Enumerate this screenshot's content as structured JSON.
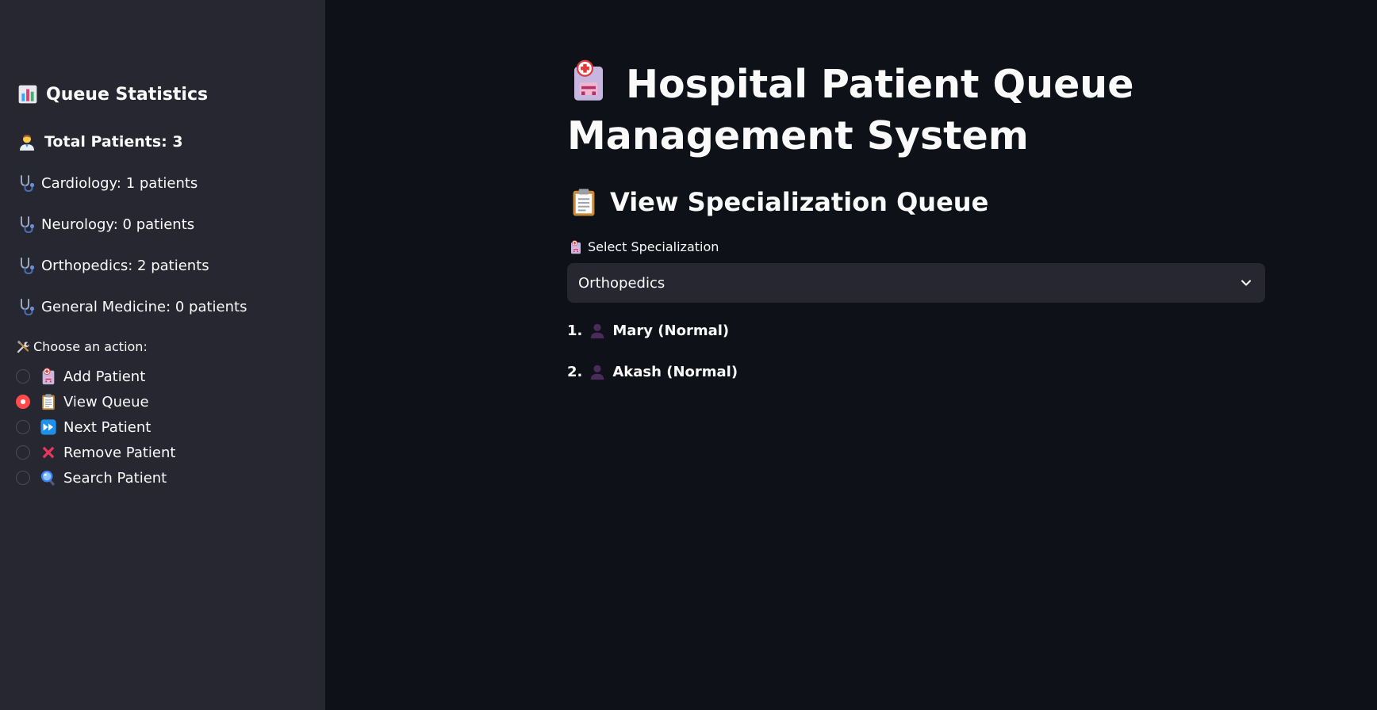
{
  "sidebar": {
    "stats_title": "Queue Statistics",
    "total_patients": "Total Patients: 3",
    "specializations": [
      {
        "label": "Cardiology: 1 patients"
      },
      {
        "label": "Neurology: 0 patients"
      },
      {
        "label": "Orthopedics: 2 patients"
      },
      {
        "label": "General Medicine: 0 patients"
      }
    ],
    "action_label": "Choose an action:",
    "actions": [
      {
        "label": "Add Patient",
        "icon": "hospital-icon",
        "selected": false
      },
      {
        "label": "View Queue",
        "icon": "clipboard-icon",
        "selected": true
      },
      {
        "label": "Next Patient",
        "icon": "fast-forward-icon",
        "selected": false
      },
      {
        "label": "Remove Patient",
        "icon": "cross-mark-icon",
        "selected": false
      },
      {
        "label": "Search Patient",
        "icon": "magnifier-icon",
        "selected": false
      }
    ]
  },
  "main": {
    "title": "Hospital Patient Queue Management System",
    "section_title": "View Specialization Queue",
    "select_label": "Select Specialization",
    "select_value": "Orthopedics",
    "queue": [
      {
        "number": "1.",
        "name": "Mary (Normal)"
      },
      {
        "number": "2.",
        "name": "Akash (Normal)"
      }
    ]
  },
  "colors": {
    "main_bg": "#0e1117",
    "sidebar_bg": "#262730",
    "accent": "#ff4b4b",
    "text": "#fafafa"
  }
}
